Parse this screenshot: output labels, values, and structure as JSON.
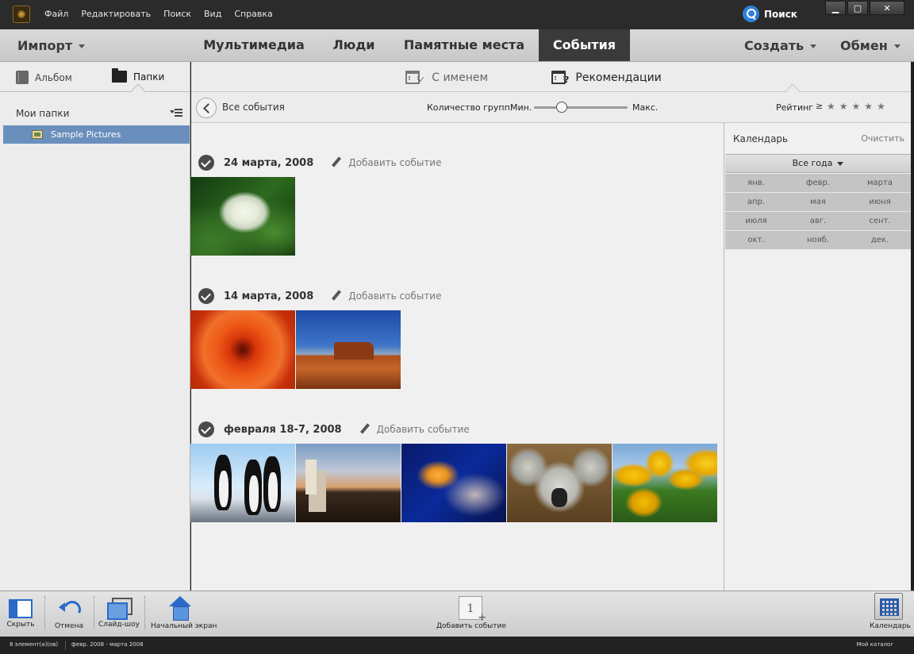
{
  "titlebar": {
    "menu": [
      "Файл",
      "Редактировать",
      "Поиск",
      "Вид",
      "Справка"
    ],
    "search_label": "Поиск",
    "window_controls": [
      "▁",
      "▢",
      "✕"
    ]
  },
  "topbar": {
    "import_label": "Импорт",
    "tabs": [
      {
        "label": "Мультимедиа",
        "active": false
      },
      {
        "label": "Люди",
        "active": false
      },
      {
        "label": "Памятные места",
        "active": false
      },
      {
        "label": "События",
        "active": true
      }
    ],
    "create_label": "Создать",
    "share_label": "Обмен"
  },
  "leftpanel": {
    "tab_album": "Альбом",
    "tab_folders": "Папки",
    "my_folders": "Мои папки",
    "folder_item": "Sample Pictures"
  },
  "viewtabs": {
    "named": "С именем",
    "named_badge": "✓",
    "recommend": "Рекомендации",
    "recommend_badge": "?"
  },
  "navbar": {
    "all_events": "Все события",
    "groups_label": "Количество групп:",
    "min_label": "Мин.",
    "max_label": "Макс.",
    "slider_position": 0.3,
    "rating_label": "Рейтинг",
    "rating_ge": "≥",
    "stars": [
      "★",
      "★",
      "★",
      "★",
      "★"
    ]
  },
  "events": [
    {
      "date": "24 марта, 2008",
      "add_label": "Добавить событие",
      "thumbs": [
        "hydrangea"
      ]
    },
    {
      "date": "14 марта, 2008",
      "add_label": "Добавить событие",
      "thumbs": [
        "chrysanthemum",
        "desert"
      ]
    },
    {
      "date": "февраля 18-7, 2008",
      "add_label": "Добавить событие",
      "thumbs": [
        "penguins",
        "lighthouse",
        "jellyfish",
        "koala",
        "tulips"
      ]
    }
  ],
  "calendar": {
    "title": "Календарь",
    "clear": "Очистить",
    "year_select": "Все года",
    "months": [
      [
        "янв.",
        "февр.",
        "марта"
      ],
      [
        "апр.",
        "мая",
        "июня"
      ],
      [
        "июля",
        "авг.",
        "сент."
      ],
      [
        "окт.",
        "нояб.",
        "дек."
      ]
    ]
  },
  "toolbar": {
    "hide": "Скрыть",
    "undo": "Отмена",
    "slideshow": "Слайд-шоу",
    "home": "Начальный экран",
    "add_event": "Добавить событие",
    "add_event_number": "1",
    "calendar": "Календарь"
  },
  "statusbar": {
    "count": "8 элемент(а)(ов)",
    "range": "февр. 2008 - марта 2008",
    "catalog": "Мой каталог"
  },
  "colors": {
    "accent_blue": "#2a6ac8",
    "active_tab_bg": "#3a3a3a",
    "selected_folder": "#6a8fbd"
  }
}
